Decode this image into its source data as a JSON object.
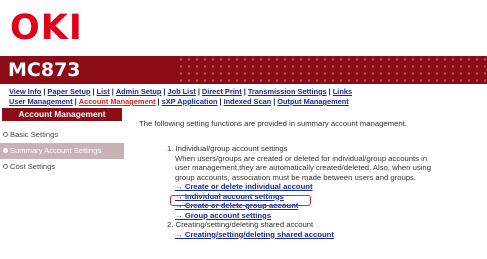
{
  "brand": {
    "logo_text": "OKI",
    "model": "MC873",
    "accent": "#8b0b17",
    "logo_color": "#e2001a"
  },
  "nav": {
    "row1": [
      "View Info",
      "Paper Setup",
      "List",
      "Admin Setup",
      "Job List",
      "Direct Print",
      "Transmission Settings",
      "Links"
    ],
    "row2": [
      "User Management",
      "Account Management",
      "sXP Application",
      "Indexed Scan",
      "Output Management"
    ],
    "active": "Account Management"
  },
  "sidebar": {
    "header": "Account Management",
    "items": [
      {
        "label": "Basic Settings",
        "selected": false
      },
      {
        "label": "Summary Account Settings",
        "selected": true
      },
      {
        "label": "Cost Settings",
        "selected": false
      }
    ]
  },
  "main": {
    "intro": "The following setting functions are provided in summary account management.",
    "section1_title": "1. Individual/group account settings",
    "section1_desc": [
      "When users/groups are created or deleted for individual/group accounts in",
      "user management,they are automatically created/deleted. Also, when using",
      "group accounts, association must be made between users and groups."
    ],
    "section1_links": [
      "→ Create or delete individual account",
      "→ Individual account settings",
      "→ Create or delete group account",
      "→ Group account settings"
    ],
    "section2_title": "2. Creating/setting/deleting shared account",
    "section2_links": [
      "→ Creating/setting/deleting shared account"
    ]
  }
}
